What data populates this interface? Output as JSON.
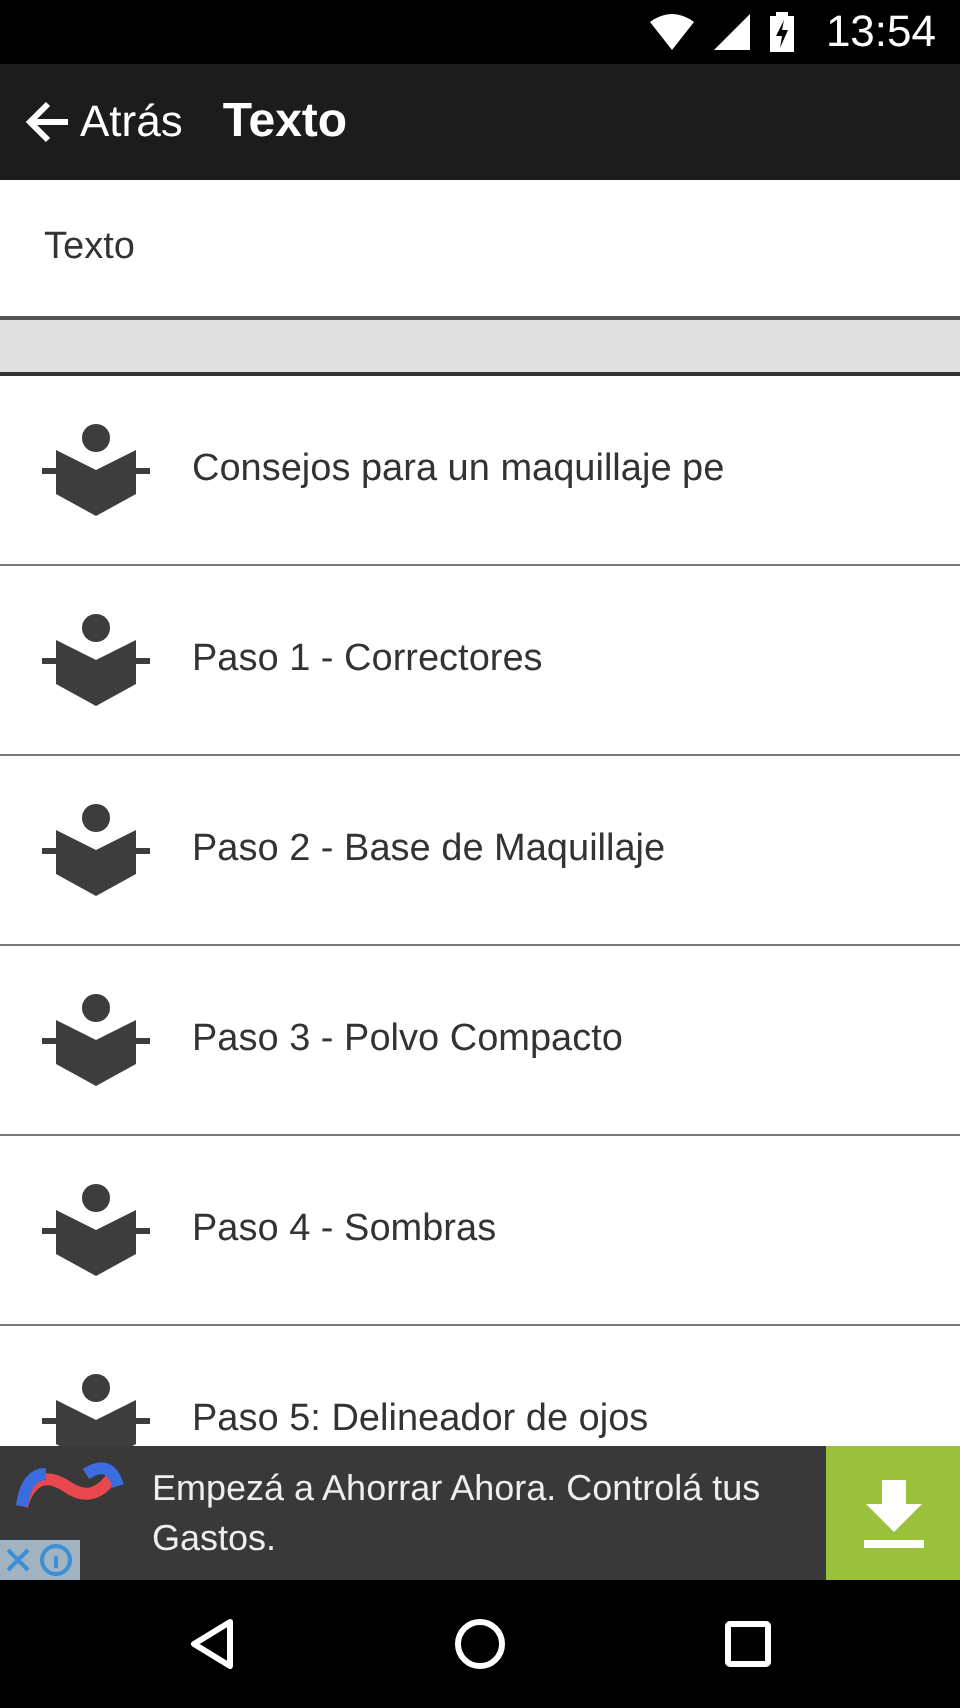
{
  "status_bar": {
    "time": "13:54"
  },
  "toolbar": {
    "back_label": "Atrás",
    "title": "Texto"
  },
  "header": {
    "text": "Texto"
  },
  "items": [
    {
      "label": "Consejos para un maquillaje pe"
    },
    {
      "label": "Paso 1 - Correctores"
    },
    {
      "label": "Paso 2 - Base de Maquillaje"
    },
    {
      "label": "Paso 3 - Polvo Compacto"
    },
    {
      "label": "Paso 4 - Sombras"
    },
    {
      "label": "Paso 5: Delineador de ojos"
    }
  ],
  "ad": {
    "text": "Empezá a Ahorrar Ahora. Controlá tus Gastos."
  }
}
